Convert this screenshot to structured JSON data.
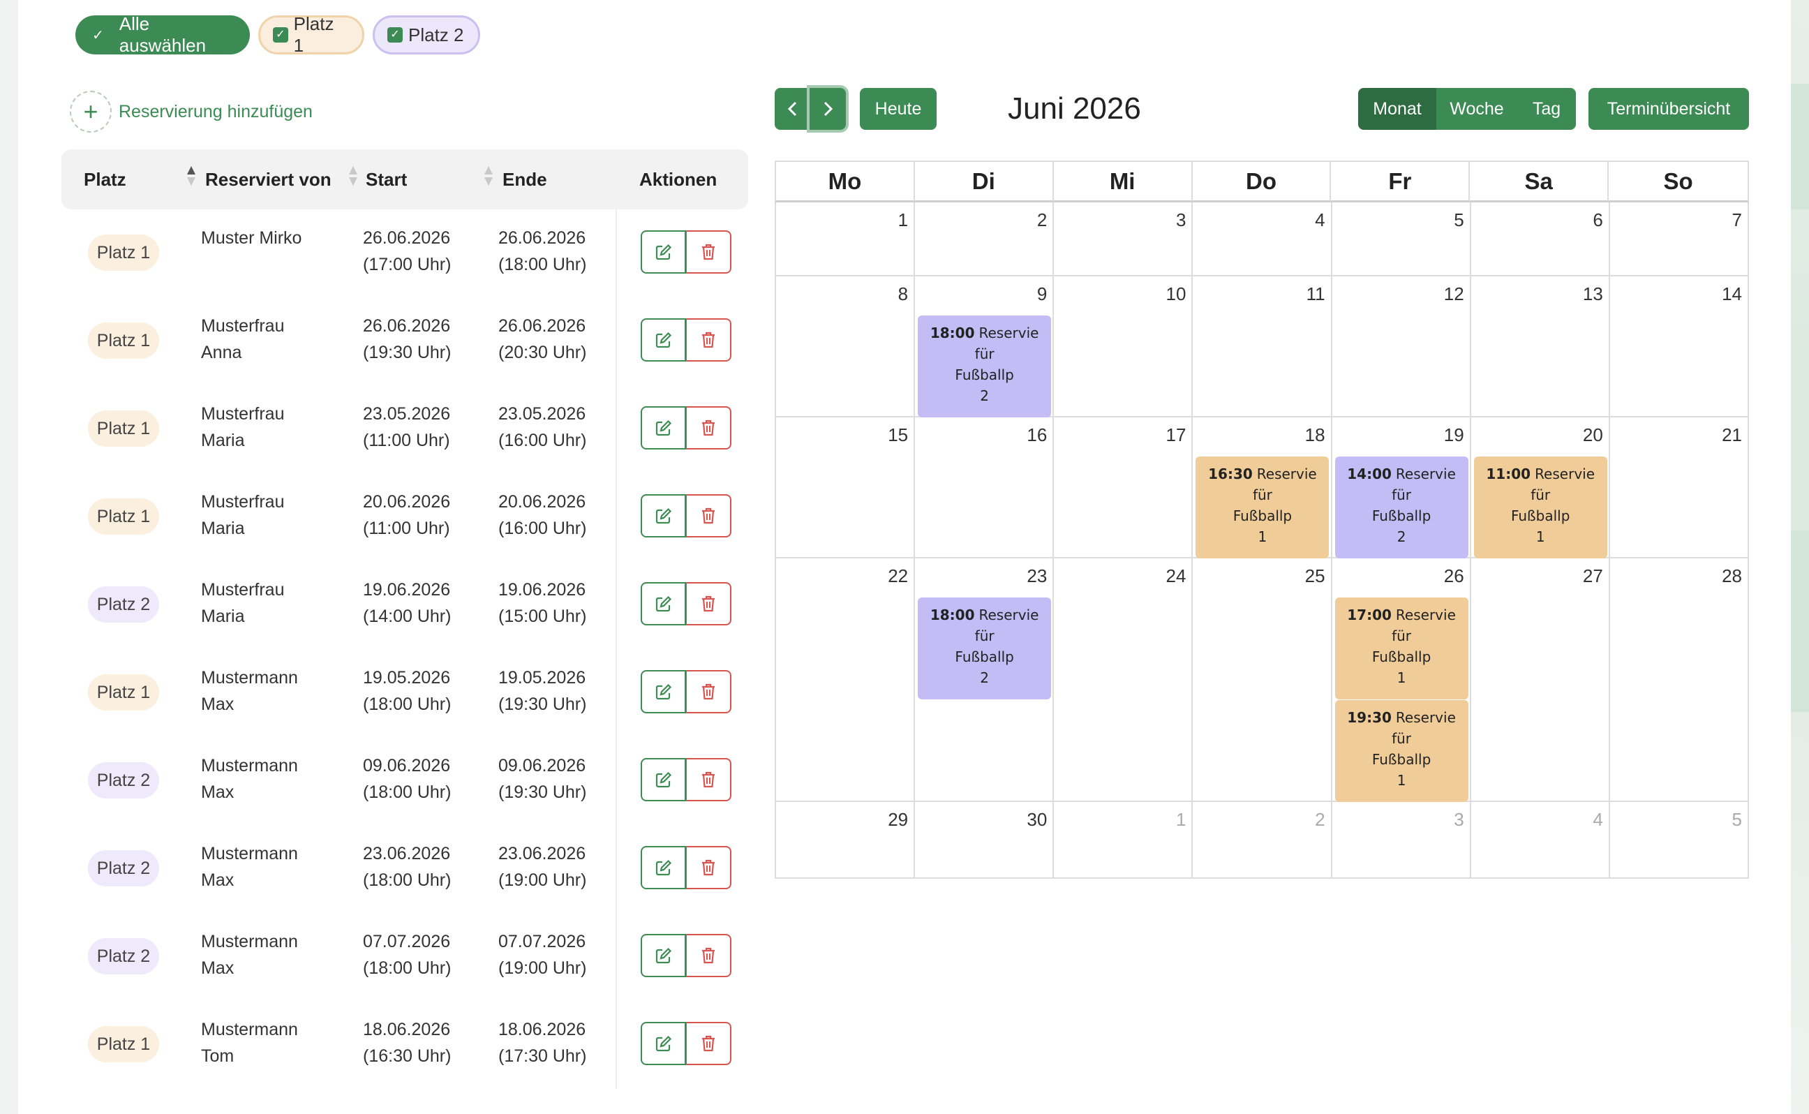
{
  "filters": {
    "select_all": "Alle auswählen",
    "platz1": "Platz 1",
    "platz2": "Platz 2"
  },
  "add_reservation": "Reservierung hinzufügen",
  "table": {
    "headers": [
      "Platz",
      "Reserviert von",
      "Start",
      "Ende",
      "Aktionen"
    ],
    "rows": [
      {
        "platz": "Platz 1",
        "name1": "Muster Mirko",
        "name2": "",
        "start_date": "26.06.2026",
        "start_time": "(17:00 Uhr)",
        "end_date": "26.06.2026",
        "end_time": "(18:00 Uhr)"
      },
      {
        "platz": "Platz 1",
        "name1": "Musterfrau",
        "name2": "Anna",
        "start_date": "26.06.2026",
        "start_time": "(19:30 Uhr)",
        "end_date": "26.06.2026",
        "end_time": "(20:30 Uhr)"
      },
      {
        "platz": "Platz 1",
        "name1": "Musterfrau",
        "name2": "Maria",
        "start_date": "23.05.2026",
        "start_time": "(11:00 Uhr)",
        "end_date": "23.05.2026",
        "end_time": "(16:00 Uhr)"
      },
      {
        "platz": "Platz 1",
        "name1": "Musterfrau",
        "name2": "Maria",
        "start_date": "20.06.2026",
        "start_time": "(11:00 Uhr)",
        "end_date": "20.06.2026",
        "end_time": "(16:00 Uhr)"
      },
      {
        "platz": "Platz 2",
        "name1": "Musterfrau",
        "name2": "Maria",
        "start_date": "19.06.2026",
        "start_time": "(14:00 Uhr)",
        "end_date": "19.06.2026",
        "end_time": "(15:00 Uhr)"
      },
      {
        "platz": "Platz 1",
        "name1": "Mustermann",
        "name2": "Max",
        "start_date": "19.05.2026",
        "start_time": "(18:00 Uhr)",
        "end_date": "19.05.2026",
        "end_time": "(19:30 Uhr)"
      },
      {
        "platz": "Platz 2",
        "name1": "Mustermann",
        "name2": "Max",
        "start_date": "09.06.2026",
        "start_time": "(18:00 Uhr)",
        "end_date": "09.06.2026",
        "end_time": "(19:30 Uhr)"
      },
      {
        "platz": "Platz 2",
        "name1": "Mustermann",
        "name2": "Max",
        "start_date": "23.06.2026",
        "start_time": "(18:00 Uhr)",
        "end_date": "23.06.2026",
        "end_time": "(19:00 Uhr)"
      },
      {
        "platz": "Platz 2",
        "name1": "Mustermann",
        "name2": "Max",
        "start_date": "07.07.2026",
        "start_time": "(18:00 Uhr)",
        "end_date": "07.07.2026",
        "end_time": "(19:00 Uhr)"
      },
      {
        "platz": "Platz 1",
        "name1": "Mustermann",
        "name2": "Tom",
        "start_date": "18.06.2026",
        "start_time": "(16:30 Uhr)",
        "end_date": "18.06.2026",
        "end_time": "(17:30 Uhr)"
      }
    ]
  },
  "calendar": {
    "prev_icon": "chevron-left-icon",
    "next_icon": "chevron-right-icon",
    "today": "Heute",
    "title": "Juni 2026",
    "views": [
      "Monat",
      "Woche",
      "Tag"
    ],
    "overview": "Terminübersicht",
    "weekdays": [
      "Mo",
      "Di",
      "Mi",
      "Do",
      "Fr",
      "Sa",
      "So"
    ],
    "weeks": [
      [
        "1",
        "2",
        "3",
        "4",
        "5",
        "6",
        "7"
      ],
      [
        "8",
        "9",
        "10",
        "11",
        "12",
        "13",
        "14"
      ],
      [
        "15",
        "16",
        "17",
        "18",
        "19",
        "20",
        "21"
      ],
      [
        "22",
        "23",
        "24",
        "25",
        "26",
        "27",
        "28"
      ],
      [
        "29",
        "30",
        "1",
        "2",
        "3",
        "4",
        "5"
      ]
    ],
    "events": [
      {
        "time": "18:00",
        "text": "Reservie für Fußballp 2",
        "l1": "Reservie",
        "l2": "für",
        "l3": "Fußballp",
        "l4": "2",
        "platz": "2"
      },
      {
        "time": "16:30",
        "text": "Reservie für Fußballp 1",
        "l1": "Reservie",
        "l2": "für",
        "l3": "Fußballp",
        "l4": "1",
        "platz": "1"
      },
      {
        "time": "14:00",
        "text": "Reservie für Fußballp 2",
        "l1": "Reservie",
        "l2": "für",
        "l3": "Fußballp",
        "l4": "2",
        "platz": "2"
      },
      {
        "time": "11:00",
        "text": "Reservie für Fußballp 1",
        "l1": "Reservie",
        "l2": "für",
        "l3": "Fußballp",
        "l4": "1",
        "platz": "1"
      },
      {
        "time": "18:00",
        "text": "Reservie für Fußballp 2",
        "l1": "Reservie",
        "l2": "für",
        "l3": "Fußballp",
        "l4": "2",
        "platz": "2"
      },
      {
        "time": "17:00",
        "text": "Reservie für Fußballp 1",
        "l1": "Reservie",
        "l2": "für",
        "l3": "Fußballp",
        "l4": "1",
        "platz": "1"
      },
      {
        "time": "19:30",
        "text": "Reservie für Fußballp 1",
        "l1": "Reservie",
        "l2": "für",
        "l3": "Fußballp",
        "l4": "1",
        "platz": "1"
      }
    ]
  },
  "colors": {
    "primary": "#3c8a54",
    "primary_dark": "#2e6b41",
    "platz1": "#f0cd98",
    "platz2": "#c4bdf5",
    "danger": "#d9534f"
  }
}
